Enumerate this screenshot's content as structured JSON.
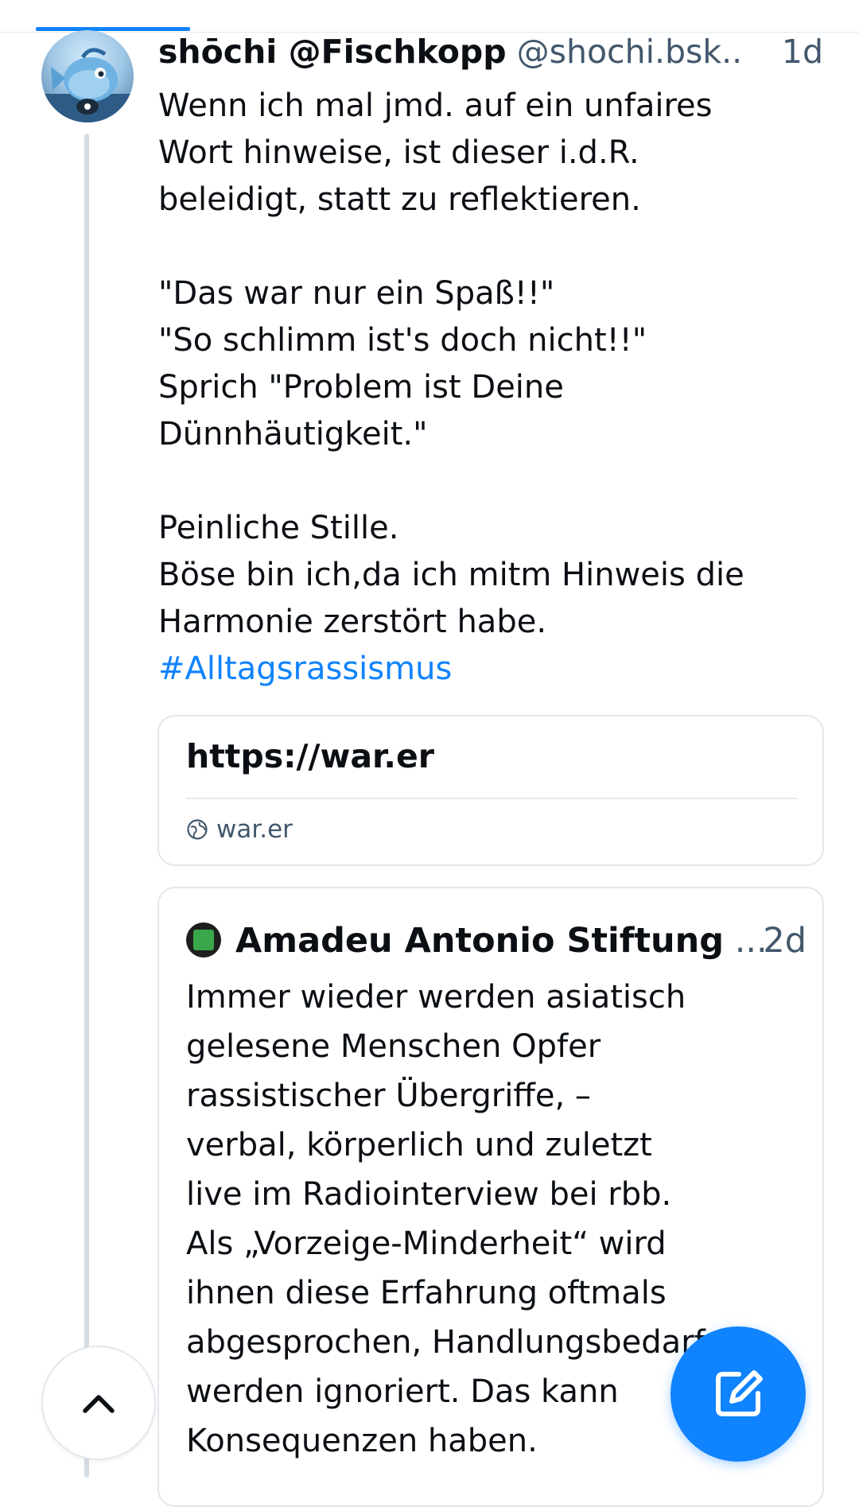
{
  "post": {
    "author_name": "shōchi @Fischkopp",
    "author_handle": "@shochi.bsk..",
    "time": "1d",
    "avatar_icon": "fish-character-avatar",
    "lines": [
      "Wenn ich mal jmd. auf ein unfaires",
      "Wort hinweise, ist dieser i.d.R.",
      "beleidigt, statt zu reflektieren.",
      "",
      "\"Das war nur ein Spaß!!\"",
      "\"So schlimm ist's doch nicht!!\"",
      "Sprich \"Problem ist Deine",
      "Dünnhäutigkeit.\"",
      "",
      "Peinliche Stille.",
      "Böse bin ich,da ich mitm Hinweis die",
      "Harmonie zerstört habe."
    ],
    "hashtag": "#Alltagsrassismus"
  },
  "link_card": {
    "title": "https://war.er",
    "domain": "war.er",
    "domain_icon": "globe-icon"
  },
  "quote": {
    "author": "Amadeu Antonio Stiftung",
    "ellipsis": "...",
    "time": "2d",
    "avatar_icon": "amadeu-antonio-stiftung-logo",
    "lines": [
      "Immer wieder werden asiatisch",
      "gelesene Menschen Opfer",
      "rassistischer Übergriffe, –",
      "verbal, körperlich und zuletzt",
      "live im Radiointerview bei rbb.",
      "Als „Vorzeige-Minderheit“ wird",
      "ihnen diese Erfahrung oftmals",
      "abgesprochen, Handlungsbedarfe",
      "werden ignoriert. Das kann",
      "Konsequenzen haben."
    ]
  },
  "controls": {
    "scroll_top_icon": "chevron-up-icon",
    "compose_icon": "compose-icon"
  },
  "colors": {
    "accent": "#1083fe",
    "text": "#0b0f14",
    "muted": "#42576c",
    "border": "#e2e7ec",
    "thread_line": "#d4dbe2"
  }
}
